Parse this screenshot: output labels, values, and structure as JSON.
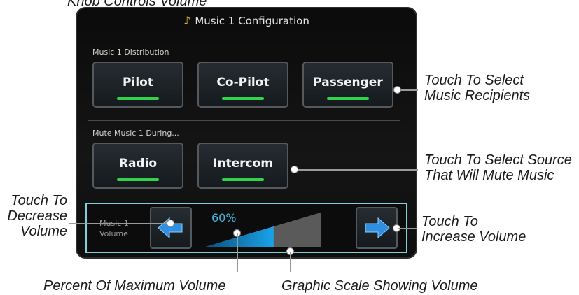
{
  "screen": {
    "title": "Music 1 Configuration",
    "distribution_label": "Music 1 Distribution",
    "distribution_buttons": [
      {
        "label": "Pilot",
        "active": true
      },
      {
        "label": "Co-Pilot",
        "active": true
      },
      {
        "label": "Passenger",
        "active": true
      }
    ],
    "mute_label": "Mute Music 1 During...",
    "mute_buttons": [
      {
        "label": "Radio",
        "active": true
      },
      {
        "label": "Intercom",
        "active": true
      }
    ],
    "volume": {
      "label_line1": "Music 1",
      "label_line2": "Volume",
      "percent_text": "60%",
      "level": 0.6
    }
  },
  "callouts": {
    "top": "Knob Controls Volume",
    "recipients": [
      "Touch To Select",
      "Music Recipients"
    ],
    "mute_source": [
      "Touch To Select Source",
      "That Will Mute Music"
    ],
    "decrease": [
      "Touch To",
      "Decrease",
      "Volume"
    ],
    "increase": [
      "Touch To",
      "Increase Volume"
    ],
    "percent": "Percent Of Maximum Volume",
    "scale": "Graphic Scale Showing Volume"
  },
  "colors": {
    "indicator": "#32d24a",
    "accent_cyan": "#44b9e0",
    "arrow_blue": "#2f8fe0"
  },
  "icons": {
    "title_icon": "music-note-icon",
    "left_arrow": "arrow-left-icon",
    "right_arrow": "arrow-right-icon"
  }
}
